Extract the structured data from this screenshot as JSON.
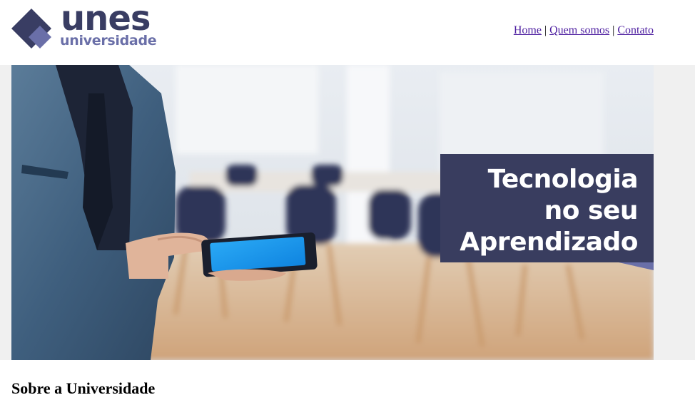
{
  "header": {
    "logo": {
      "primary": "unes",
      "secondary": "universidade"
    },
    "nav": [
      {
        "label": "Home"
      },
      {
        "label": "Quem somos"
      },
      {
        "label": "Contato"
      }
    ],
    "separator": "|"
  },
  "banner": {
    "caption_lines": [
      "Tecnologia",
      "no seu",
      "Aprendizado"
    ]
  },
  "content": {
    "section_title": "Sobre a Universidade"
  },
  "colors": {
    "brand_dark": "#393d63",
    "brand_light": "#6a6fa8",
    "link": "#4d1ea0",
    "caption_bg": "#393d5f"
  }
}
